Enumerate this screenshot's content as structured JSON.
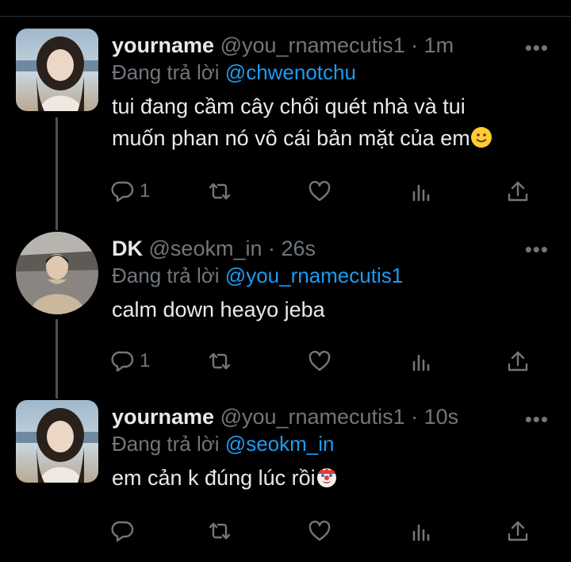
{
  "tweets": [
    {
      "name": "yourname",
      "handle": "@you_rnamecutis1",
      "separator": "·",
      "time": "1m",
      "reply_prefix": "Đang trả lời",
      "reply_to": "@chwenotchu",
      "text_line1": "tui đang cầm cây chổi quét nhà và tui",
      "text_line2": "muốn phan nó vô cái bản mặt của em",
      "emoji": "slightly-smiling-face",
      "reply_count": "1",
      "more_label": "•••"
    },
    {
      "name": "DK",
      "handle": "@seokm_in",
      "separator": "·",
      "time": "26s",
      "reply_prefix": "Đang trả lời",
      "reply_to": "@you_rnamecutis1",
      "text_line1": "calm down heayo jeba",
      "reply_count": "1",
      "more_label": "•••"
    },
    {
      "name": "yourname",
      "handle": "@you_rnamecutis1",
      "separator": "·",
      "time": "10s",
      "reply_prefix": "Đang trả lời",
      "reply_to": "@seokm_in",
      "text_line1": "em cản k đúng lúc rồi",
      "emoji": "clown-face",
      "more_label": "•••"
    }
  ],
  "icons": {
    "reply": "reply-icon",
    "retweet": "retweet-icon",
    "like": "heart-icon",
    "views": "views-icon",
    "share": "share-icon",
    "more": "more-icon"
  },
  "colors": {
    "background": "#000000",
    "text": "#e7e9ea",
    "muted": "#71767b",
    "link": "#1d9bf0"
  }
}
